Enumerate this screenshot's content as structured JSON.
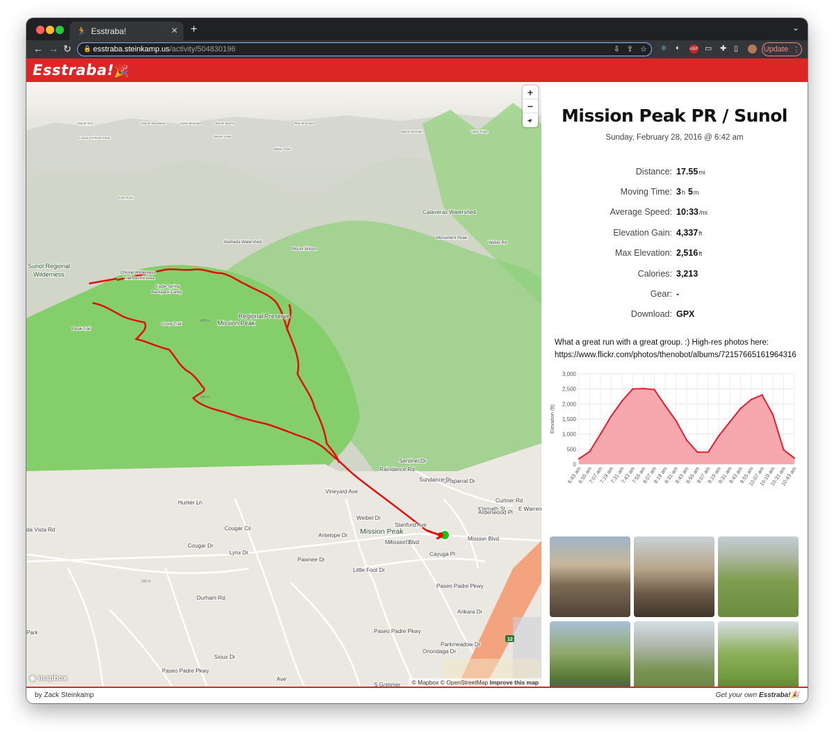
{
  "browser": {
    "tab_title": "Esstraba!",
    "url_host": "esstraba.steinkamp.us",
    "url_path": "/activity/504830196",
    "update_label": "Update"
  },
  "app": {
    "logo": "Esstraba!",
    "logo_emoji": "🎉"
  },
  "map": {
    "labels": [
      {
        "text": "Sunol Regional",
        "cls": "park"
      },
      {
        "text": "Wilderness",
        "cls": "park"
      },
      {
        "text": "Mission Peak",
        "cls": "peakbig"
      },
      {
        "text": "Regional Preserve",
        "cls": "park"
      },
      {
        "text": "Mission Peak",
        "cls": "park"
      },
      {
        "text": "Calaveras Watershed",
        "cls": "park2"
      },
      {
        "text": "Eagle Spring",
        "cls": "small"
      },
      {
        "text": "Backpack Camp",
        "cls": "small"
      },
      {
        "text": "Ohlone Wilderness",
        "cls": "small"
      },
      {
        "text": "Trail Permit Area",
        "cls": "small"
      },
      {
        "text": "Alameda Watershed",
        "cls": "small"
      },
      {
        "text": "Mount Allison",
        "cls": "small"
      },
      {
        "text": "Monument Peak",
        "cls": "small"
      },
      {
        "text": "Weller Rd",
        "cls": "small"
      },
      {
        "text": "Peak Trail",
        "cls": "small"
      },
      {
        "text": "Grove Trail",
        "cls": "small"
      },
      {
        "text": "Hunter Ln",
        "cls": "road"
      },
      {
        "text": "Mission Blvd",
        "cls": "road"
      },
      {
        "text": "Mission Blvd",
        "cls": "road"
      },
      {
        "text": "Mission Blvd",
        "cls": "road"
      },
      {
        "text": "Vineyard Ave",
        "cls": "road"
      },
      {
        "text": "Weibel Dr",
        "cls": "road"
      },
      {
        "text": "Sentinel Dr",
        "cls": "road"
      },
      {
        "text": "Raindance Rd",
        "cls": "road"
      },
      {
        "text": "Chaparral Dr",
        "cls": "road"
      },
      {
        "text": "Klamath St",
        "cls": "road"
      },
      {
        "text": "E Warren",
        "cls": "road"
      },
      {
        "text": "Cougar Cir",
        "cls": "road"
      },
      {
        "text": "Cougar Dr",
        "cls": "road"
      },
      {
        "text": "Lynx Dr",
        "cls": "road"
      },
      {
        "text": "Pawnee Dr",
        "cls": "road"
      },
      {
        "text": "Durham Rd",
        "cls": "road"
      },
      {
        "text": "Antelope Dr",
        "cls": "road"
      },
      {
        "text": "Little Foot Dr",
        "cls": "road"
      },
      {
        "text": "Cayuga Pl",
        "cls": "road"
      },
      {
        "text": "Paseo Padre Pkwy",
        "cls": "road"
      },
      {
        "text": "Paseo Padre Pkwy",
        "cls": "road"
      },
      {
        "text": "Arikara Dr",
        "cls": "road"
      },
      {
        "text": "Parkmeadow Dr",
        "cls": "road"
      },
      {
        "text": "Onondaga Dr",
        "cls": "road"
      },
      {
        "text": "Sioux Dr",
        "cls": "road"
      },
      {
        "text": "S Grimmer",
        "cls": "road"
      },
      {
        "text": "Paseo Padre Pkwy",
        "cls": "road"
      },
      {
        "text": "Ave",
        "cls": "road"
      },
      {
        "text": "Park",
        "cls": "road"
      },
      {
        "text": "da Vista Rd",
        "cls": "road"
      },
      {
        "text": "Stanford Ave",
        "cls": "road"
      },
      {
        "text": "12",
        "cls": "shield"
      },
      {
        "text": "Sundance Dr",
        "cls": "road"
      },
      {
        "text": "Curtner Rd",
        "cls": "road"
      },
      {
        "text": "Mount Ose",
        "cls": "tiny"
      },
      {
        "text": "Mount Boardman",
        "cls": "tiny"
      },
      {
        "text": "Eylar Mountain",
        "cls": "tiny"
      },
      {
        "text": "Mount Mocho",
        "cls": "tiny"
      },
      {
        "text": "Red Mountain",
        "cls": "tiny"
      },
      {
        "text": "Black Mountain",
        "cls": "tiny"
      },
      {
        "text": "Mount Lewis",
        "cls": "tiny"
      },
      {
        "text": "Lookout Point",
        "cls": "tiny"
      },
      {
        "text": "Rose Peak",
        "cls": "tiny"
      },
      {
        "text": "Bailey Peak",
        "cls": "tiny"
      },
      {
        "text": "Goat Rock",
        "cls": "tiny"
      },
      {
        "text": "Valpe Ridge",
        "cls": "tiny"
      },
      {
        "text": "Hunter Ln",
        "cls": "road"
      },
      {
        "text": "Ardenwood Pl",
        "cls": "road"
      },
      {
        "text": "400 m",
        "cls": "contour"
      },
      {
        "text": "300 m",
        "cls": "contour"
      },
      {
        "text": "200 m",
        "cls": "contour"
      },
      {
        "text": "100 m",
        "cls": "contour"
      }
    ],
    "logo": "mapbox",
    "attribution_prefix": "© Mapbox © OpenStreetMap",
    "attribution_link": "Improve this map",
    "zoom_in": "+",
    "zoom_out": "−",
    "compass": "◂·"
  },
  "activity": {
    "title": "Mission Peak PR / Sunol",
    "date": "Sunday, February 28, 2016 @ 6:42 am",
    "stats": [
      {
        "label": "Distance:",
        "value": "17.55",
        "unit": "mi"
      },
      {
        "label": "Moving Time:",
        "value": "3",
        "unit": "h",
        "value2": "5",
        "unit2": "m"
      },
      {
        "label": "Average Speed:",
        "value": "10:33",
        "unit": "/mi"
      },
      {
        "label": "Elevation Gain:",
        "value": "4,337",
        "unit": "ft"
      },
      {
        "label": "Max Elevation:",
        "value": "2,516",
        "unit": "ft"
      },
      {
        "label": "Calories:",
        "value": "3,213",
        "unit": ""
      },
      {
        "label": "Gear:",
        "value": "-",
        "unit": ""
      },
      {
        "label": "Download:",
        "value": "GPX",
        "unit": ""
      }
    ],
    "description_line1": "What a great run with a great group. :) High-res photos here:",
    "description_line2": "https://www.flickr.com/photos/thenobot/albums/72157665161964316"
  },
  "chart_data": {
    "type": "area",
    "ylabel": "Elevation (ft)",
    "xlabel": "",
    "ylim": [
      0,
      3000
    ],
    "yticks": [
      "0",
      "500",
      "1,000",
      "1,500",
      "2,000",
      "2,500",
      "3,000"
    ],
    "categories": [
      "6:43 am",
      "6:55 am",
      "7:07 am",
      "7:19 am",
      "7:31 am",
      "7:43 am",
      "7:55 am",
      "8:07 am",
      "8:19 am",
      "8:31 am",
      "8:43 am",
      "8:55 am",
      "9:07 am",
      "9:19 am",
      "9:31 am",
      "9:43 am",
      "9:55 am",
      "10:07 am",
      "10:19 am",
      "10:31 am",
      "10:43 am"
    ],
    "series": [
      {
        "values": [
          180,
          420,
          1000,
          1600,
          2100,
          2500,
          2510,
          2480,
          1950,
          1450,
          800,
          400,
          400,
          950,
          1400,
          1850,
          2150,
          2300,
          1650,
          480,
          200
        ],
        "color": "#e11d2e",
        "fill": "#f7a8ae"
      }
    ]
  },
  "photos": [
    {
      "name": "photo-1"
    },
    {
      "name": "photo-2"
    },
    {
      "name": "photo-3"
    },
    {
      "name": "photo-4"
    },
    {
      "name": "photo-5"
    },
    {
      "name": "photo-6"
    }
  ],
  "footer": {
    "author": "by Zack Steinkamp",
    "cta_prefix": "Get your own",
    "cta_brand": "Esstraba!",
    "cta_emoji": "🎉"
  },
  "colors": {
    "brand": "#dc2626",
    "route": "#e10e0e",
    "park": "#8ed27a",
    "terrain": "#d9dccf"
  }
}
